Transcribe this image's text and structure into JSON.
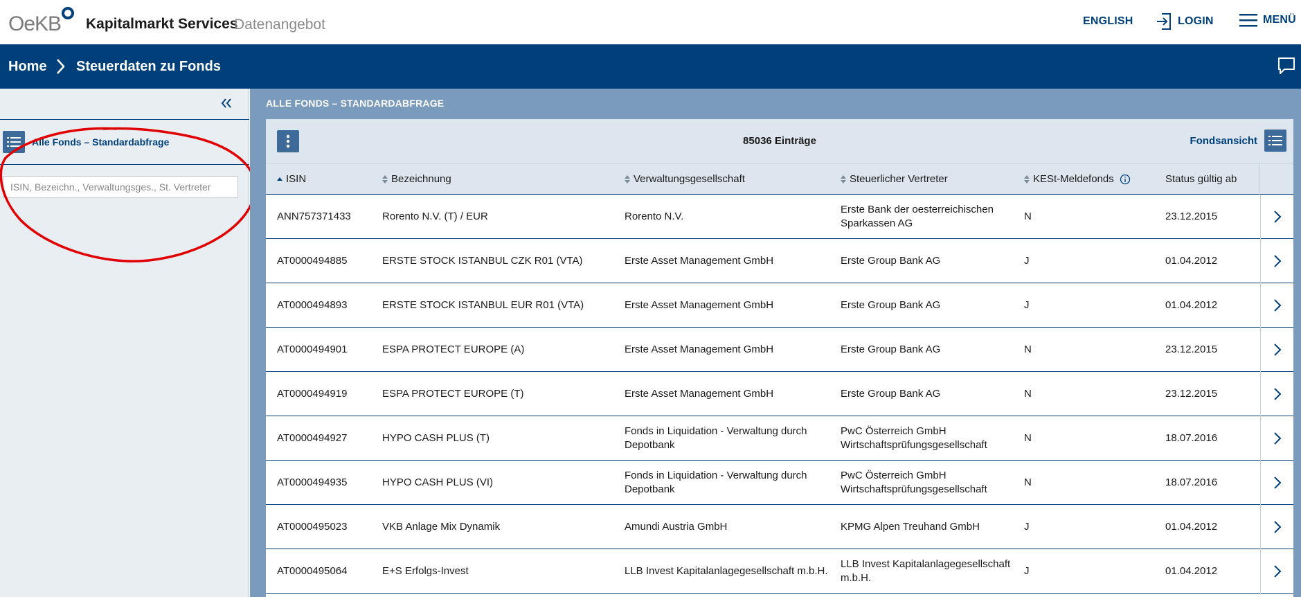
{
  "header": {
    "logo_text": "OeKB",
    "app_title": "Kapitalmarkt Services",
    "app_subtitle": "Datenangebot",
    "english_label": "ENGLISH",
    "login_label": "LOGIN",
    "menu_label": "MENÜ",
    "brand_color": "#00407a"
  },
  "breadcrumb": {
    "home": "Home",
    "current": "Steuerdaten zu Fonds"
  },
  "sidebar": {
    "item_label": "Alle Fonds – Standardabfrage",
    "search_placeholder": "ISIN, Bezeichn., Verwaltungsges., St. Vertreter",
    "search_value": ""
  },
  "main": {
    "title": "ALLE FONDS – STANDARDABFRAGE",
    "entries": "85036 Einträge",
    "view_label": "Fondsansicht"
  },
  "table": {
    "columns": {
      "isin": "ISIN",
      "name": "Bezeichnung",
      "kvg": "Verwaltungsgesellschaft",
      "rep": "Steuerlicher Vertreter",
      "kest": "KESt-Meldefonds",
      "date": "Status gültig ab"
    },
    "rows": [
      {
        "isin": "ANN757371433",
        "name": "Rorento N.V. (T) / EUR",
        "kvg": "Rorento N.V.",
        "rep": "Erste Bank der oesterreichischen Sparkassen AG",
        "kest": "N",
        "date": "23.12.2015"
      },
      {
        "isin": "AT0000494885",
        "name": "ERSTE STOCK ISTANBUL CZK R01 (VTA)",
        "kvg": "Erste Asset Management GmbH",
        "rep": "Erste Group Bank AG",
        "kest": "J",
        "date": "01.04.2012"
      },
      {
        "isin": "AT0000494893",
        "name": "ERSTE STOCK ISTANBUL EUR R01 (VTA)",
        "kvg": "Erste Asset Management GmbH",
        "rep": "Erste Group Bank AG",
        "kest": "J",
        "date": "01.04.2012"
      },
      {
        "isin": "AT0000494901",
        "name": "ESPA PROTECT EUROPE (A)",
        "kvg": "Erste Asset Management GmbH",
        "rep": "Erste Group Bank AG",
        "kest": "N",
        "date": "23.12.2015"
      },
      {
        "isin": "AT0000494919",
        "name": "ESPA PROTECT EUROPE (T)",
        "kvg": "Erste Asset Management GmbH",
        "rep": "Erste Group Bank AG",
        "kest": "N",
        "date": "23.12.2015"
      },
      {
        "isin": "AT0000494927",
        "name": "HYPO CASH PLUS (T)",
        "kvg": "Fonds in Liquidation - Verwaltung durch Depotbank",
        "rep": "PwC Österreich GmbH Wirtschaftsprüfungsgesellschaft",
        "kest": "N",
        "date": "18.07.2016"
      },
      {
        "isin": "AT0000494935",
        "name": "HYPO CASH PLUS (VI)",
        "kvg": "Fonds in Liquidation - Verwaltung durch Depotbank",
        "rep": "PwC Österreich GmbH Wirtschaftsprüfungsgesellschaft",
        "kest": "N",
        "date": "18.07.2016"
      },
      {
        "isin": "AT0000495023",
        "name": "VKB Anlage Mix Dynamik",
        "kvg": "Amundi Austria GmbH",
        "rep": "KPMG Alpen Treuhand GmbH",
        "kest": "J",
        "date": "01.04.2012"
      },
      {
        "isin": "AT0000495064",
        "name": "E+S Erfolgs-Invest",
        "kvg": "LLB Invest Kapitalanlagegesellschaft m.b.H.",
        "rep": "LLB Invest Kapitalanlagegesellschaft m.b.H.",
        "kest": "J",
        "date": "01.04.2012"
      }
    ]
  }
}
